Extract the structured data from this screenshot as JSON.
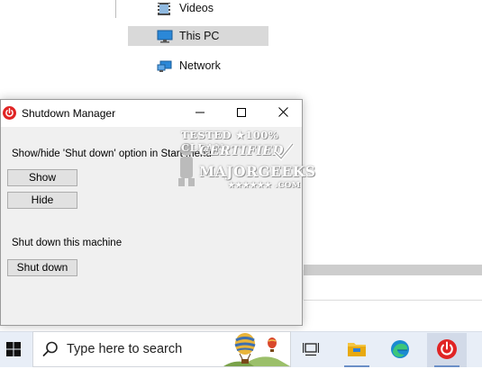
{
  "explorer": {
    "nav_items": [
      {
        "label": "Videos",
        "icon": "videos-folder-icon"
      },
      {
        "label": "This PC",
        "icon": "this-pc-icon"
      },
      {
        "label": "Network",
        "icon": "network-icon"
      }
    ],
    "selected": "This PC"
  },
  "window": {
    "title": "Shutdown Manager",
    "icon": "power-icon",
    "section1_label": "Show/hide 'Shut down' option in Start menu",
    "show_button": "Show",
    "hide_button": "Hide",
    "section2_label": "Shut down this machine",
    "shutdown_button": "Shut down"
  },
  "watermark": {
    "line1": "TESTED ★100% CLEAN",
    "line2": "CERTIFIED",
    "line3": "MAJORGEEKS",
    "line4": "★★★★★★ .COM"
  },
  "taskbar": {
    "search_placeholder": "Type here to search",
    "apps": [
      "task-view-icon",
      "file-explorer-icon",
      "edge-icon",
      "shutdown-manager-icon"
    ]
  },
  "colors": {
    "power_red": "#e02424",
    "selection": "#d9d9d9",
    "taskbar_bg": "#e8eef7"
  }
}
